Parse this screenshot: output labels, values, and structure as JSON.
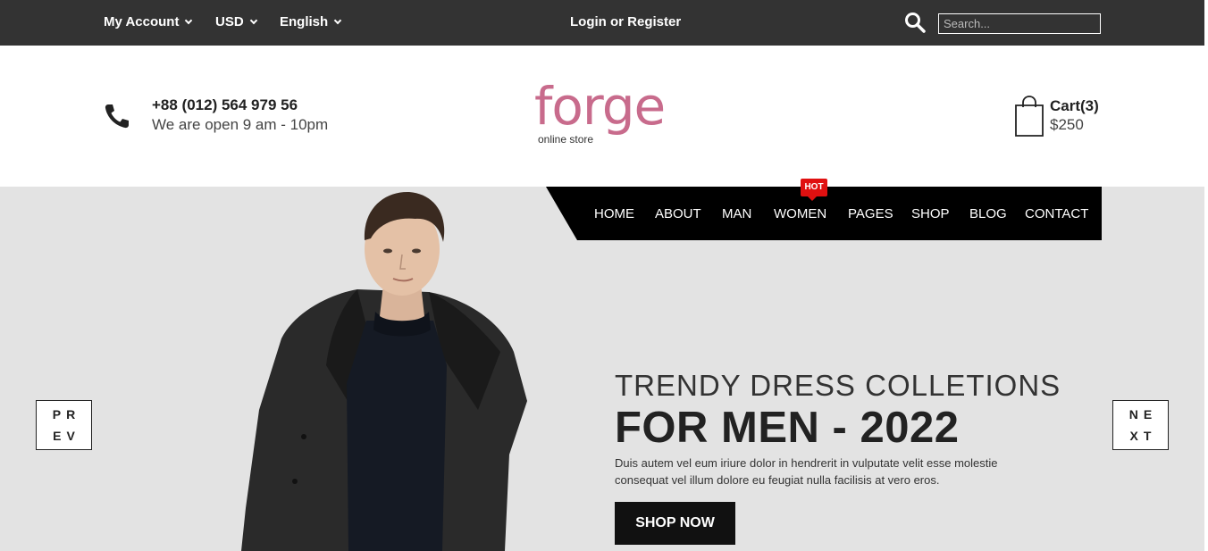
{
  "topbar": {
    "account_label": "My Account",
    "currency_label": "USD",
    "language_label": "English",
    "login_label": "Login or Register",
    "search_placeholder": "Search..."
  },
  "header": {
    "phone": "+88 (012) 564 979 56",
    "hours": "We are open 9 am - 10pm",
    "logo_text": "forge",
    "logo_tagline": "online store",
    "cart_label": "Cart(3)",
    "cart_total": "$250"
  },
  "nav": {
    "items": [
      "HOME",
      "ABOUT",
      "MAN",
      "WOMEN",
      "PAGES",
      "SHOP",
      "BLOG",
      "CONTACT"
    ],
    "badge": "HOT"
  },
  "hero": {
    "subtitle": "TRENDY DRESS COLLETIONS",
    "title": "FOR MEN - 2022",
    "description_line1": "Duis autem vel eum iriure dolor in hendrerit in vulputate velit esse molestie",
    "description_line2": "consequat vel illum dolore eu feugiat nulla facilisis at vero eros.",
    "cta_label": "SHOP NOW",
    "prev_line1": "PR",
    "prev_line2": "EV",
    "next_line1": "NE",
    "next_line2": "XT"
  },
  "colors": {
    "topbar_bg": "#333333",
    "brand": "#c86b8c",
    "hero_bg": "#e3e3e3",
    "nav_bg": "#000000",
    "badge": "#e01010"
  },
  "icons": {
    "search": "search-icon",
    "phone": "phone-icon",
    "cart": "shopping-bag-icon"
  }
}
